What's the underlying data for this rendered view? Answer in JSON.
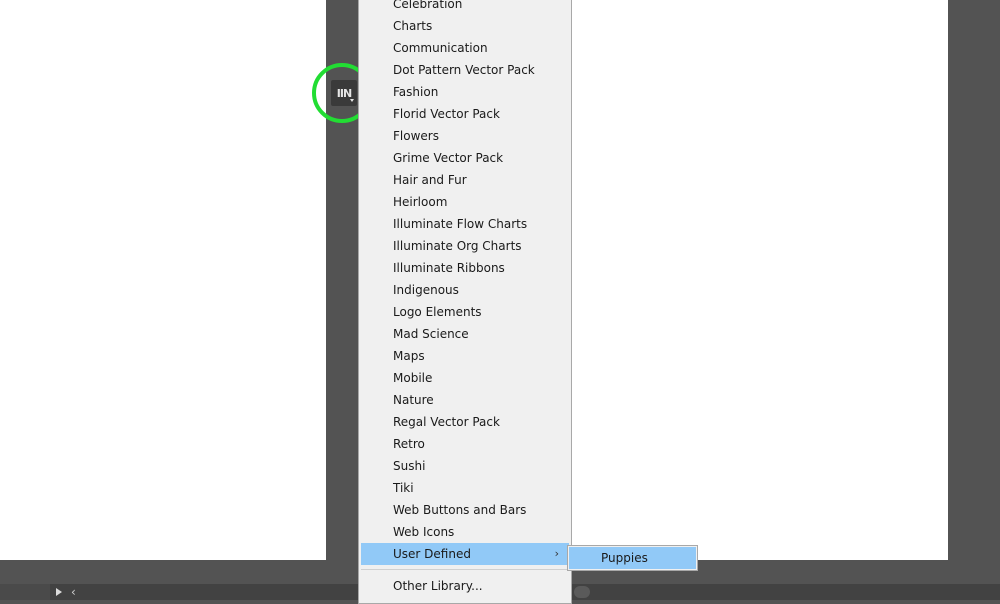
{
  "toolbar": {
    "library_icon": "symbol-libraries-icon",
    "highlight_color": "#22dd33"
  },
  "menu": {
    "items": [
      {
        "label": "Celebration"
      },
      {
        "label": "Charts"
      },
      {
        "label": "Communication"
      },
      {
        "label": "Dot Pattern Vector Pack"
      },
      {
        "label": "Fashion"
      },
      {
        "label": "Florid Vector Pack"
      },
      {
        "label": "Flowers"
      },
      {
        "label": "Grime Vector Pack"
      },
      {
        "label": "Hair and Fur"
      },
      {
        "label": "Heirloom"
      },
      {
        "label": "Illuminate Flow Charts"
      },
      {
        "label": "Illuminate Org Charts"
      },
      {
        "label": "Illuminate Ribbons"
      },
      {
        "label": "Indigenous"
      },
      {
        "label": "Logo Elements"
      },
      {
        "label": "Mad Science"
      },
      {
        "label": "Maps"
      },
      {
        "label": "Mobile"
      },
      {
        "label": "Nature"
      },
      {
        "label": "Regal Vector Pack"
      },
      {
        "label": "Retro"
      },
      {
        "label": "Sushi"
      },
      {
        "label": "Tiki"
      },
      {
        "label": "Web Buttons and Bars"
      },
      {
        "label": "Web Icons"
      }
    ],
    "active_item": {
      "label": "User Defined",
      "arrow": "›"
    },
    "other_library": {
      "label": "Other Library..."
    },
    "highlight_color": "#91c9f7"
  },
  "submenu": {
    "items": [
      {
        "label": "Puppies"
      }
    ]
  },
  "status_bar": {
    "prev_glyph": "‹"
  }
}
